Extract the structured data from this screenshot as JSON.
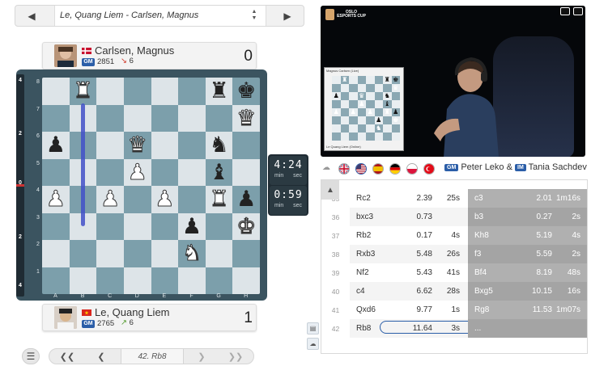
{
  "game_selector": {
    "title": "Le, Quang Liem - Carlsen, Magnus",
    "prev_icon": "chevron-left-icon",
    "next_icon": "chevron-right-icon"
  },
  "top_player": {
    "name": "Carlsen, Magnus",
    "title_badge": "GM",
    "rating": "2851",
    "rating_change": "6",
    "score": "0",
    "flag": "denmark"
  },
  "bottom_player": {
    "name": "Le, Quang Liem",
    "title_badge": "GM",
    "rating": "2765",
    "rating_change": "6",
    "score": "1",
    "flag": "vietnam"
  },
  "board": {
    "files": [
      "A",
      "B",
      "C",
      "D",
      "E",
      "F",
      "G",
      "H"
    ],
    "ranks": [
      "8",
      "7",
      "6",
      "5",
      "4",
      "3",
      "2",
      "1"
    ],
    "eval_labels": [
      "4",
      "2",
      "0",
      "2",
      "4"
    ],
    "position": [
      [
        "",
        "wR",
        "",
        "",
        "",
        "",
        "bR",
        "bK"
      ],
      [
        "",
        "",
        "",
        "",
        "",
        "",
        "",
        "wQ"
      ],
      [
        "bP",
        "",
        "",
        "wQ",
        "",
        "",
        "bN",
        ""
      ],
      [
        "",
        "",
        "",
        "wP",
        "",
        "",
        "bB",
        ""
      ],
      [
        "wP",
        "",
        "wP",
        "",
        "wP",
        "",
        "wR",
        "bP"
      ],
      [
        "",
        "",
        "",
        "",
        "",
        "bP",
        "",
        "wK"
      ],
      [
        "",
        "",
        "",
        "",
        "",
        "wN",
        "",
        ""
      ],
      [
        "",
        "",
        "",
        "",
        "",
        "",
        "",
        ""
      ]
    ]
  },
  "clocks": {
    "top": {
      "time": "4:24",
      "min": "min",
      "sec": "sec"
    },
    "bottom": {
      "time": "0:59",
      "min": "min",
      "sec": "sec"
    }
  },
  "controls": {
    "current_move": "42. Rb8",
    "menu_icon": "menu-icon"
  },
  "video": {
    "brand_line1": "OSLO",
    "brand_line2": "ESPORTS CUP",
    "mini_board_title": "Magnus Carlsen (Live)",
    "mini_board_footer": "Le Quang Liem (Online)"
  },
  "commentary": {
    "commentator1_title": "GM",
    "commentator1": "Peter Leko",
    "separator": "&",
    "commentator2_title": "IM",
    "commentator2": "Tania Sachdev",
    "flags": [
      "uk",
      "usa",
      "spain",
      "germany",
      "poland",
      "turkey"
    ]
  },
  "moves": [
    {
      "num": "35",
      "white": "Rc2",
      "white_eval": "2.39",
      "white_time": "25s",
      "black": "c3",
      "black_eval": "2.01",
      "black_time": "1m16s"
    },
    {
      "num": "36",
      "white": "bxc3",
      "white_eval": "0.73",
      "white_time": "",
      "black": "b3",
      "black_eval": "0.27",
      "black_time": "2s"
    },
    {
      "num": "37",
      "white": "Rb2",
      "white_eval": "0.17",
      "white_time": "4s",
      "black": "Kh8",
      "black_eval": "5.19",
      "black_time": "4s"
    },
    {
      "num": "38",
      "white": "Rxb3",
      "white_eval": "5.48",
      "white_time": "26s",
      "black": "f3",
      "black_eval": "5.59",
      "black_time": "2s"
    },
    {
      "num": "39",
      "white": "Nf2",
      "white_eval": "5.43",
      "white_time": "41s",
      "black": "Bf4",
      "black_eval": "8.19",
      "black_time": "48s"
    },
    {
      "num": "40",
      "white": "c4",
      "white_eval": "6.62",
      "white_time": "28s",
      "black": "Bxg5",
      "black_eval": "10.15",
      "black_time": "16s"
    },
    {
      "num": "41",
      "white": "Qxd6",
      "white_eval": "9.77",
      "white_time": "1s",
      "black": "Rg8",
      "black_eval": "11.53",
      "black_time": "1m07s"
    },
    {
      "num": "42",
      "white": "Rb8",
      "white_eval": "11.64",
      "white_time": "3s",
      "black": "...",
      "black_eval": "",
      "black_time": ""
    }
  ]
}
